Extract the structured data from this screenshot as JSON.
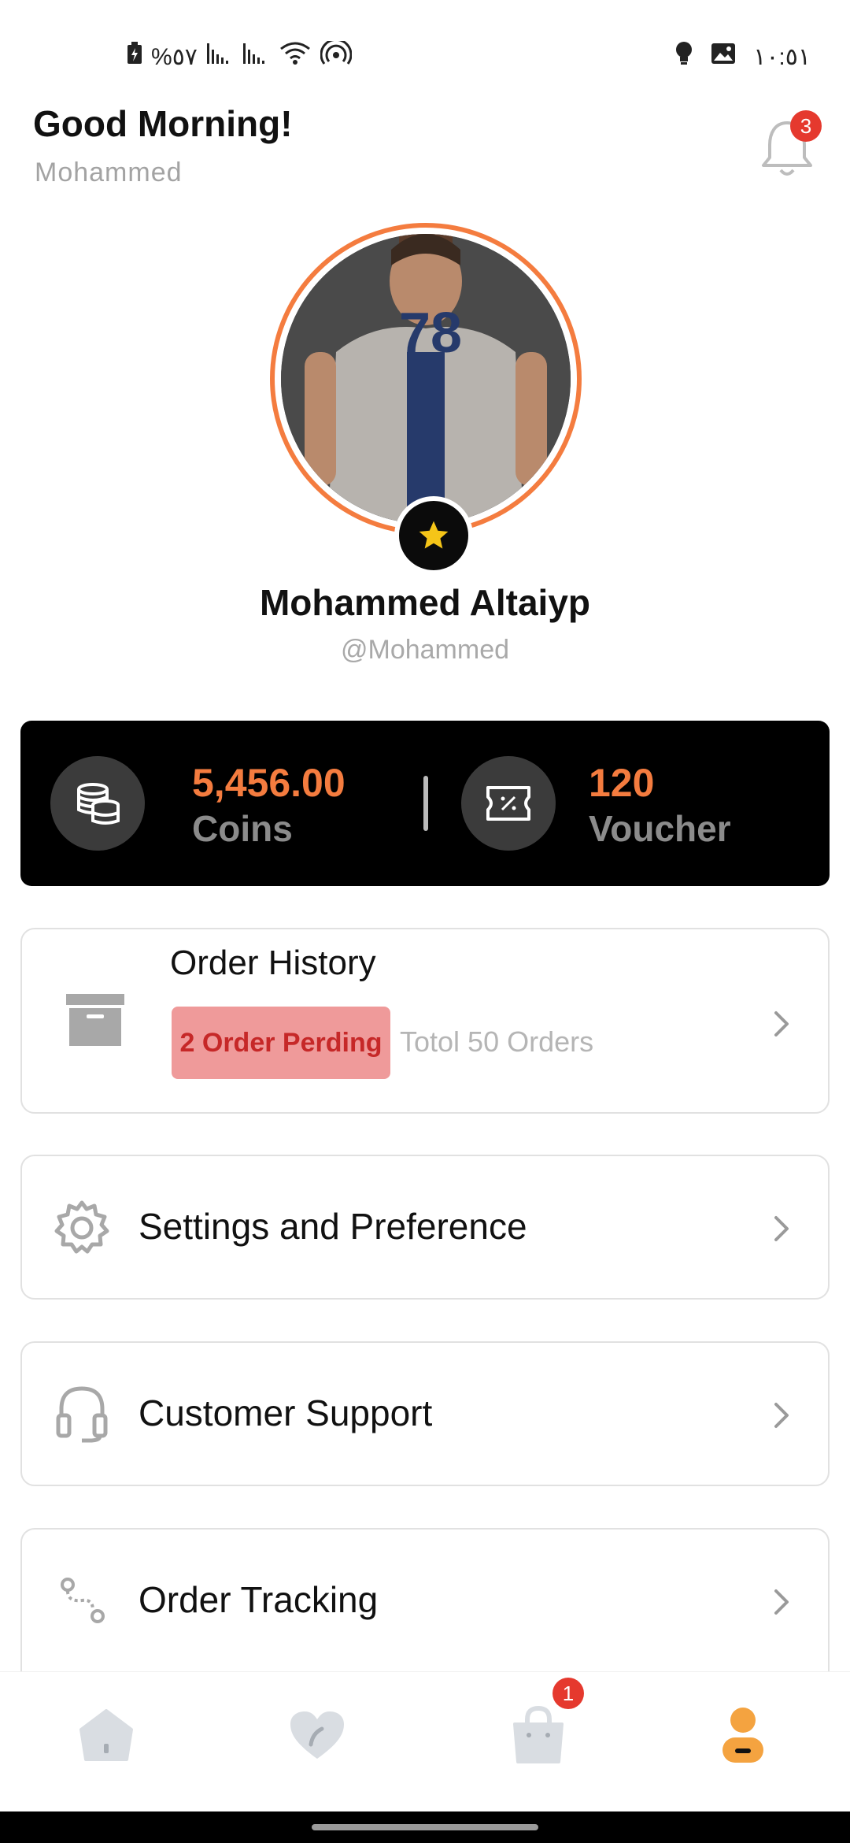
{
  "status_bar": {
    "battery": "%٥٧",
    "time": "١٠:٥١"
  },
  "header": {
    "greeting": "Good Morning!",
    "name": "Mohammed",
    "notification_count": "3"
  },
  "profile": {
    "full_name": "Mohammed Altaiyp",
    "handle": "@Mohammed"
  },
  "stats": {
    "coins_value": "5,456.00",
    "coins_label": "Coins",
    "voucher_value": "120",
    "voucher_label": "Voucher"
  },
  "order_history": {
    "title": "Order History",
    "pending_badge": "2 Order Perding",
    "total": "Totol 50 Orders"
  },
  "menu": {
    "settings": "Settings and Preference",
    "support": "Customer Support",
    "tracking": "Order Tracking"
  },
  "bottom_nav": {
    "cart_count": "1"
  },
  "colors": {
    "accent": "#f47c3f",
    "badge_red": "#e5392e",
    "pending_bg": "#ef9a9a",
    "pending_text": "#c62828"
  }
}
